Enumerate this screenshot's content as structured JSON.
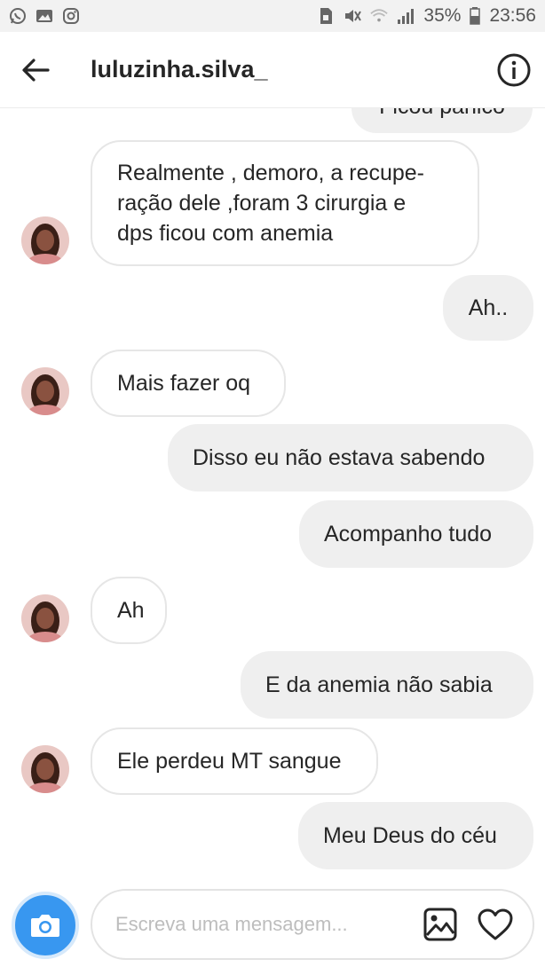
{
  "status_bar": {
    "battery_percent": "35%",
    "time": "23:56"
  },
  "header": {
    "username": "luluzinha.silva_"
  },
  "messages": [
    {
      "direction": "out",
      "text": "Ficou pânico",
      "partial": true
    },
    {
      "direction": "in",
      "lines": [
        "Realmente , demoro, a recupe-",
        "ração dele ,foram 3 cirurgia e",
        "dps ficou com anemia"
      ]
    },
    {
      "direction": "out",
      "text": "Ah.."
    },
    {
      "direction": "in",
      "text": "Mais fazer oq"
    },
    {
      "direction": "out",
      "text": "Disso eu não estava sabendo"
    },
    {
      "direction": "out",
      "text": "Acompanho tudo"
    },
    {
      "direction": "in",
      "text": "Ah"
    },
    {
      "direction": "out",
      "text": "E da anemia não sabia"
    },
    {
      "direction": "in",
      "text": "Ele perdeu MT sangue"
    },
    {
      "direction": "out",
      "text": "Meu Deus do céu"
    }
  ],
  "composer": {
    "placeholder": "Escreva uma mensagem..."
  },
  "icons": {
    "back": "arrow-left-icon",
    "info": "info-icon",
    "camera": "camera-icon",
    "gallery": "image-icon",
    "like": "heart-icon"
  },
  "colors": {
    "accent": "#3897f0",
    "outgoing_bubble": "#efefef",
    "incoming_border": "#e6e6e6"
  }
}
